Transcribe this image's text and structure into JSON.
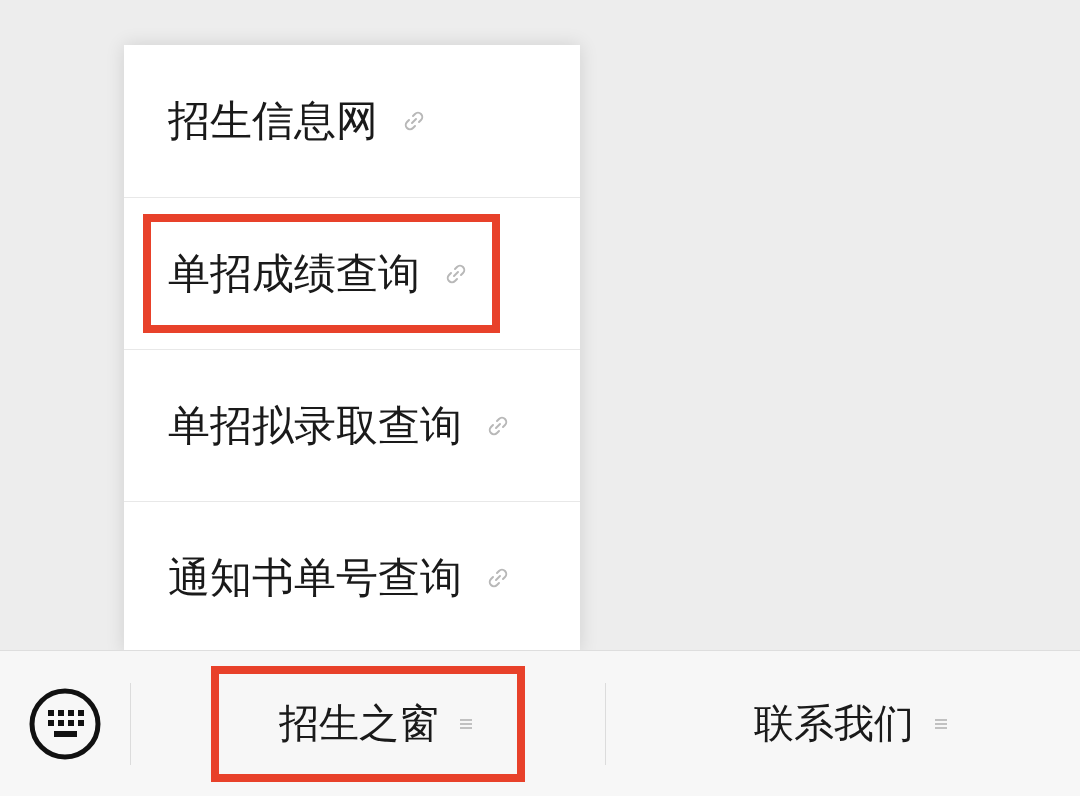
{
  "menu": {
    "items": [
      {
        "label": "招生信息网",
        "highlighted": false
      },
      {
        "label": "单招成绩查询",
        "highlighted": true
      },
      {
        "label": "单招拟录取查询",
        "highlighted": false
      },
      {
        "label": "通知书单号查询",
        "highlighted": false
      }
    ]
  },
  "bottom_bar": {
    "tabs": [
      {
        "label": "招生之窗",
        "highlighted": true
      },
      {
        "label": "联系我们",
        "highlighted": false
      }
    ]
  }
}
